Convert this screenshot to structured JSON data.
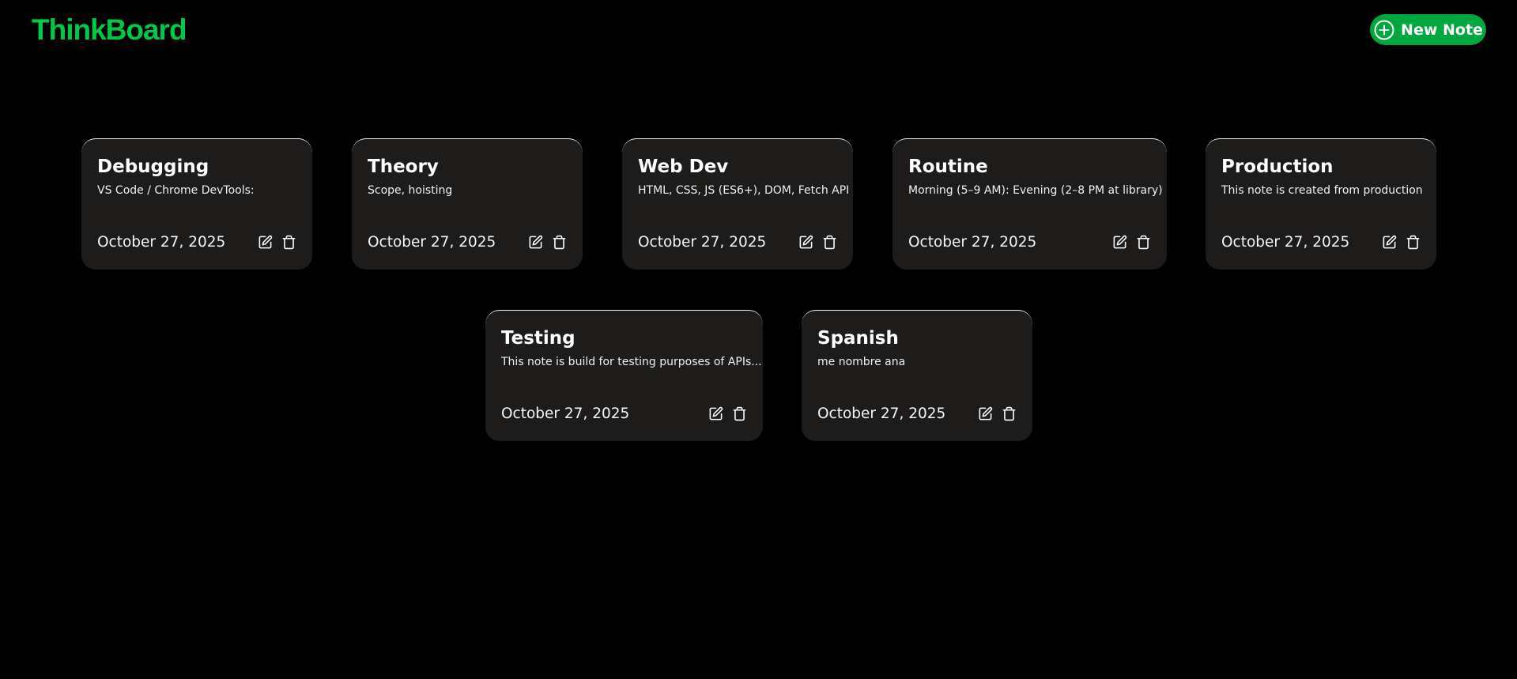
{
  "app": {
    "title": "ThinkBoard",
    "new_note_label": "New Note",
    "accent_color": "#00c94a",
    "button_color": "#00a63e"
  },
  "notes": [
    {
      "title": "Debugging",
      "snippet": "VS Code / Chrome DevTools:",
      "date": "October 27, 2025"
    },
    {
      "title": "Theory",
      "snippet": "Scope, hoisting",
      "date": "October 27, 2025"
    },
    {
      "title": "Web Dev",
      "snippet": "HTML, CSS, JS (ES6+), DOM, Fetch API",
      "date": "October 27, 2025"
    },
    {
      "title": "Routine",
      "snippet": "Morning (5–9 AM): Evening (2–8 PM at library)",
      "date": "October 27, 2025"
    },
    {
      "title": "Production",
      "snippet": "This note is created from production",
      "date": "October 27, 2025"
    },
    {
      "title": "Testing",
      "snippet": "This note is build for testing purposes of APIs...",
      "date": "October 27, 2025"
    },
    {
      "title": "Spanish",
      "snippet": "me nombre ana",
      "date": "October 27, 2025"
    }
  ],
  "icons": {
    "new_note": "plus-circle-icon",
    "edit": "edit-icon",
    "delete": "trash-icon"
  }
}
